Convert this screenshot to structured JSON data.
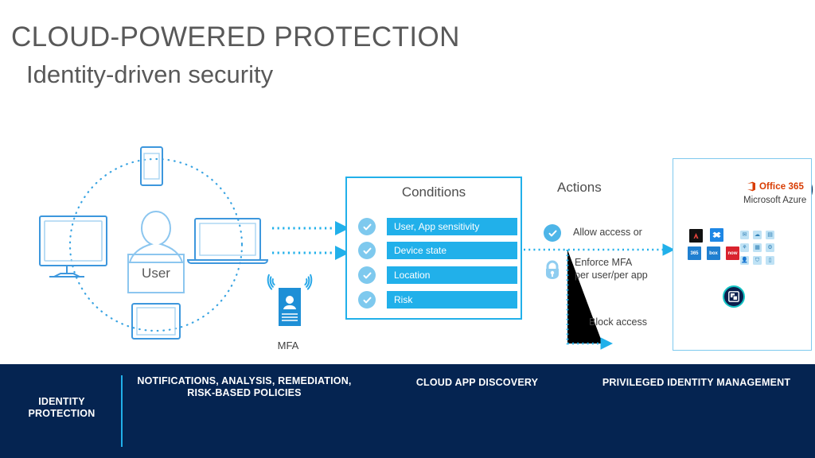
{
  "slide": {
    "title": "CLOUD-POWERED PROTECTION",
    "subtitle": "Identity-driven security",
    "background": "#ffffff"
  },
  "colors": {
    "accent_cyan": "#21b0ea",
    "light_blue": "#7ec9ee",
    "mid_blue": "#4db5e8",
    "navy": "#052451",
    "office_orange": "#d83b01",
    "text_gray": "#595959",
    "teal_ring": "#14c4c4"
  },
  "left_cluster": {
    "user_label": "User",
    "devices": [
      {
        "name": "phone",
        "position": "top"
      },
      {
        "name": "desktop-monitor",
        "position": "left"
      },
      {
        "name": "laptop",
        "position": "right"
      },
      {
        "name": "tablet",
        "position": "bottom"
      }
    ],
    "mfa": {
      "label": "MFA",
      "icon": "badge-card-icon"
    }
  },
  "conditions": {
    "title": "Conditions",
    "items": [
      {
        "label": "User, App sensitivity",
        "checked": true
      },
      {
        "label": "Device state",
        "checked": true
      },
      {
        "label": "Location",
        "checked": true
      },
      {
        "label": "Risk",
        "checked": true
      }
    ]
  },
  "actions": {
    "title": "Actions",
    "items": [
      {
        "label": "Allow access or",
        "icon": "check-circle-icon"
      },
      {
        "label": "Enforce MFA per user/per app",
        "icon": "lock-icon"
      },
      {
        "label": "Block access",
        "icon": "none"
      }
    ]
  },
  "cloud_panel": {
    "office_365": "Office 365",
    "azure": "Microsoft Azure",
    "app_tiles": [
      {
        "label": "",
        "bg": "#111111",
        "name": "adobe-tile"
      },
      {
        "label": "",
        "bg": "#1e87e5",
        "name": "dropbox-tile"
      },
      {
        "label": "365",
        "bg": "#1f7fd0",
        "name": "office365-tile"
      },
      {
        "label": "box",
        "bg": "#1f7fd0",
        "name": "box-tile"
      },
      {
        "label": "now",
        "bg": "#d9232e",
        "name": "servicenow-tile"
      }
    ],
    "grid_icons": [
      "mail-icon",
      "cloud-icon",
      "window-icon",
      "person-network-icon",
      "grid-icon",
      "gear-icon",
      "user-icon",
      "shield-icon",
      "device-icon"
    ],
    "badge_icon": "cloud-app-discovery-icon"
  },
  "bottom_bar": {
    "background": "#052451",
    "sections": [
      {
        "title": "IDENTITY\nPROTECTION",
        "title_lines": [
          "IDENTITY",
          "PROTECTION"
        ],
        "icon": "none"
      },
      {
        "title_lines": [
          "NOTIFICATIONS, ANALYSIS, REMEDIATION,",
          "RISK-BASED POLICIES"
        ],
        "icon": "magnifier-bolt-icon"
      },
      {
        "title_lines": [
          "CLOUD APP DISCOVERY"
        ],
        "icon": "cloud-apps-icon"
      },
      {
        "title_lines": [
          "PRIVILEGED IDENTITY MANAGEMENT"
        ],
        "icon": "user-key-icon"
      }
    ]
  }
}
